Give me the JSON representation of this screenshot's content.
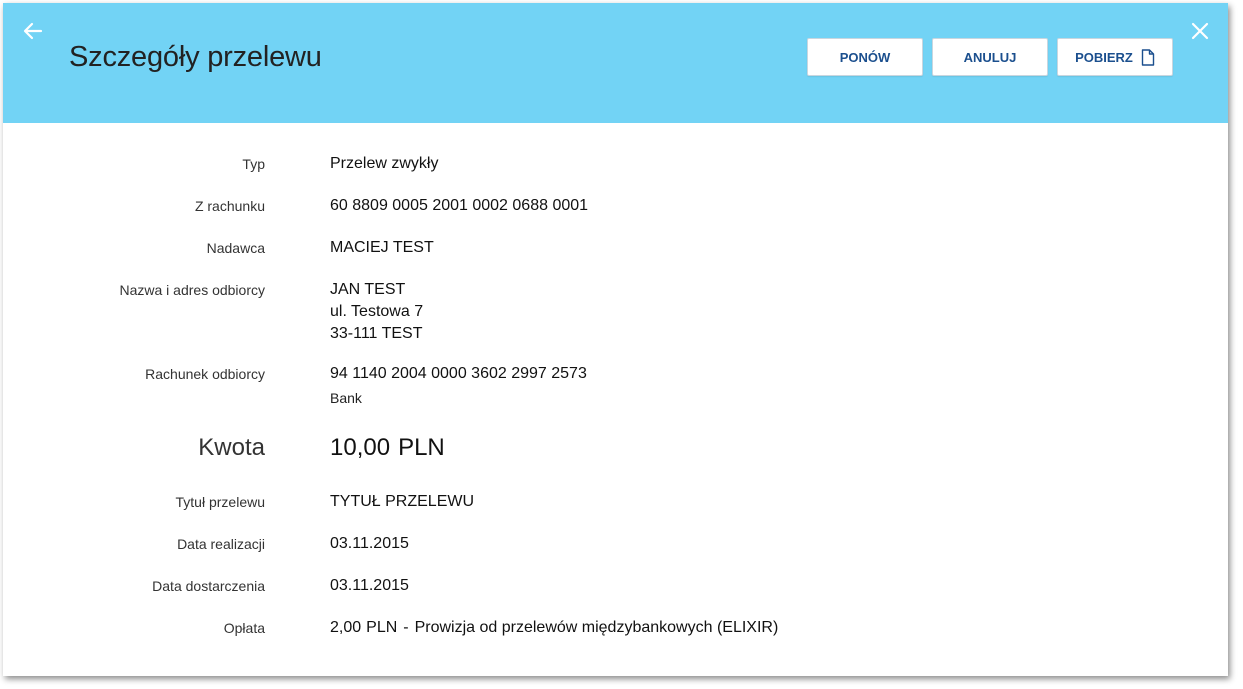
{
  "header": {
    "title": "Szczegóły przelewu",
    "buttons": {
      "retry": "PONÓW",
      "cancel": "ANULUJ",
      "download": "POBIERZ"
    }
  },
  "details": {
    "type": {
      "label": "Typ",
      "value": "Przelew zwykły"
    },
    "from_account": {
      "label": "Z rachunku",
      "value": "60 8809 0005 2001 0002 0688 0001"
    },
    "sender": {
      "label": "Nadawca",
      "value": "MACIEJ TEST"
    },
    "recipient": {
      "label": "Nazwa i adres odbiorcy",
      "lines": [
        "JAN TEST",
        "ul. Testowa 7",
        "33-111 TEST"
      ]
    },
    "recipient_account": {
      "label": "Rachunek odbiorcy",
      "value": "94 1140 2004 0000 3602 2997 2573",
      "bank": "Bank"
    },
    "amount": {
      "label": "Kwota",
      "value": "10,00",
      "currency": "PLN"
    },
    "transfer_title": {
      "label": "Tytuł przelewu",
      "value": "TYTUŁ PRZELEWU"
    },
    "execution_date": {
      "label": "Data realizacji",
      "value": "03.11.2015"
    },
    "delivery_date": {
      "label": "Data dostarczenia",
      "value": "03.11.2015"
    },
    "fee": {
      "label": "Opłata",
      "value": "2,00",
      "currency": "PLN",
      "separator": "-",
      "description": "Prowizja od przelewów międzybankowych (ELIXIR)"
    }
  },
  "colors": {
    "header_bg": "#72d3f5",
    "button_text": "#1b4f8e"
  },
  "icons": {
    "back": "arrow-left-icon",
    "close": "close-icon",
    "download": "document-icon"
  }
}
